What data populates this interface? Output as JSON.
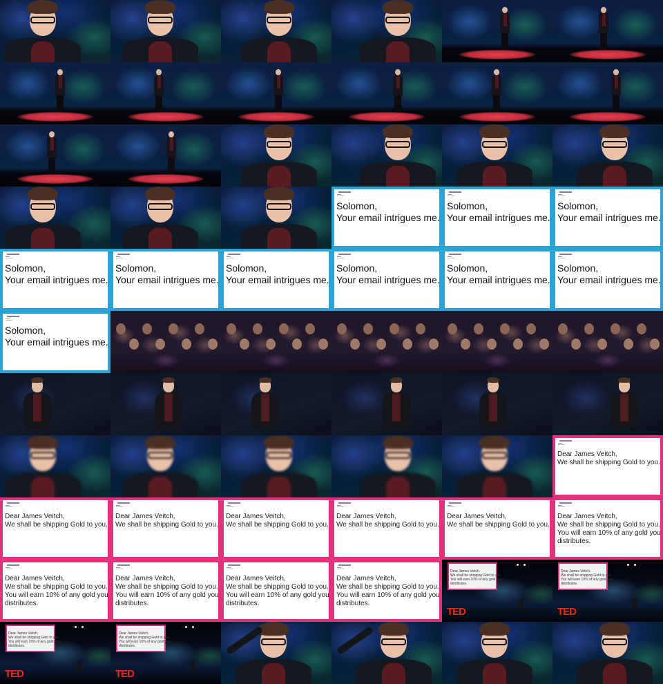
{
  "grid": {
    "columns": 6,
    "rows": 11
  },
  "slides": {
    "solomon": {
      "line1": "Solomon,",
      "line2": "Your email intrigues me."
    },
    "gold_short": {
      "line1": "Dear James Veitch,",
      "line2": "We shall be shipping Gold to you."
    },
    "gold_long": {
      "line1": "Dear James Veitch,",
      "line2": "We shall be shipping Gold to you.",
      "line3": "You will earn 10% of any gold you",
      "line4": "distributes."
    },
    "ted_logo": "TED"
  },
  "colors": {
    "solomon_border": "#29a3d6",
    "gold_border": "#e3337d",
    "ted_red": "#e62b1e",
    "stage_carpet": "#d43545"
  },
  "tiles": [
    "closeup",
    "closeup",
    "closeup",
    "closeup",
    "wide",
    "wide",
    "wide",
    "wide",
    "wide",
    "wide",
    "wide",
    "wide",
    "wide",
    "wide",
    "closeup",
    "closeup",
    "closeup",
    "closeup",
    "closeup",
    "closeup",
    "closeup",
    "slide-solomon",
    "slide-solomon",
    "slide-solomon",
    "slide-solomon",
    "slide-solomon",
    "slide-solomon",
    "slide-solomon",
    "slide-solomon",
    "slide-solomon",
    "slide-solomon",
    "audience",
    "audience",
    "audience",
    "audience",
    "audience",
    "mid",
    "mid",
    "mid",
    "mid",
    "mid",
    "mid",
    "closeup-blur",
    "closeup-blur",
    "closeup-blur",
    "closeup-blur",
    "closeup-blur",
    "slide-gold-short",
    "slide-gold-short",
    "slide-gold-short",
    "slide-gold-short",
    "slide-gold-short",
    "slide-gold-short",
    "slide-gold-long",
    "slide-gold-long",
    "slide-gold-long",
    "slide-gold-long",
    "slide-gold-long",
    "ted-wide",
    "ted-wide",
    "ted-wide",
    "ted-wide",
    "closeup-wave",
    "closeup-wave",
    "closeup",
    "closeup"
  ]
}
